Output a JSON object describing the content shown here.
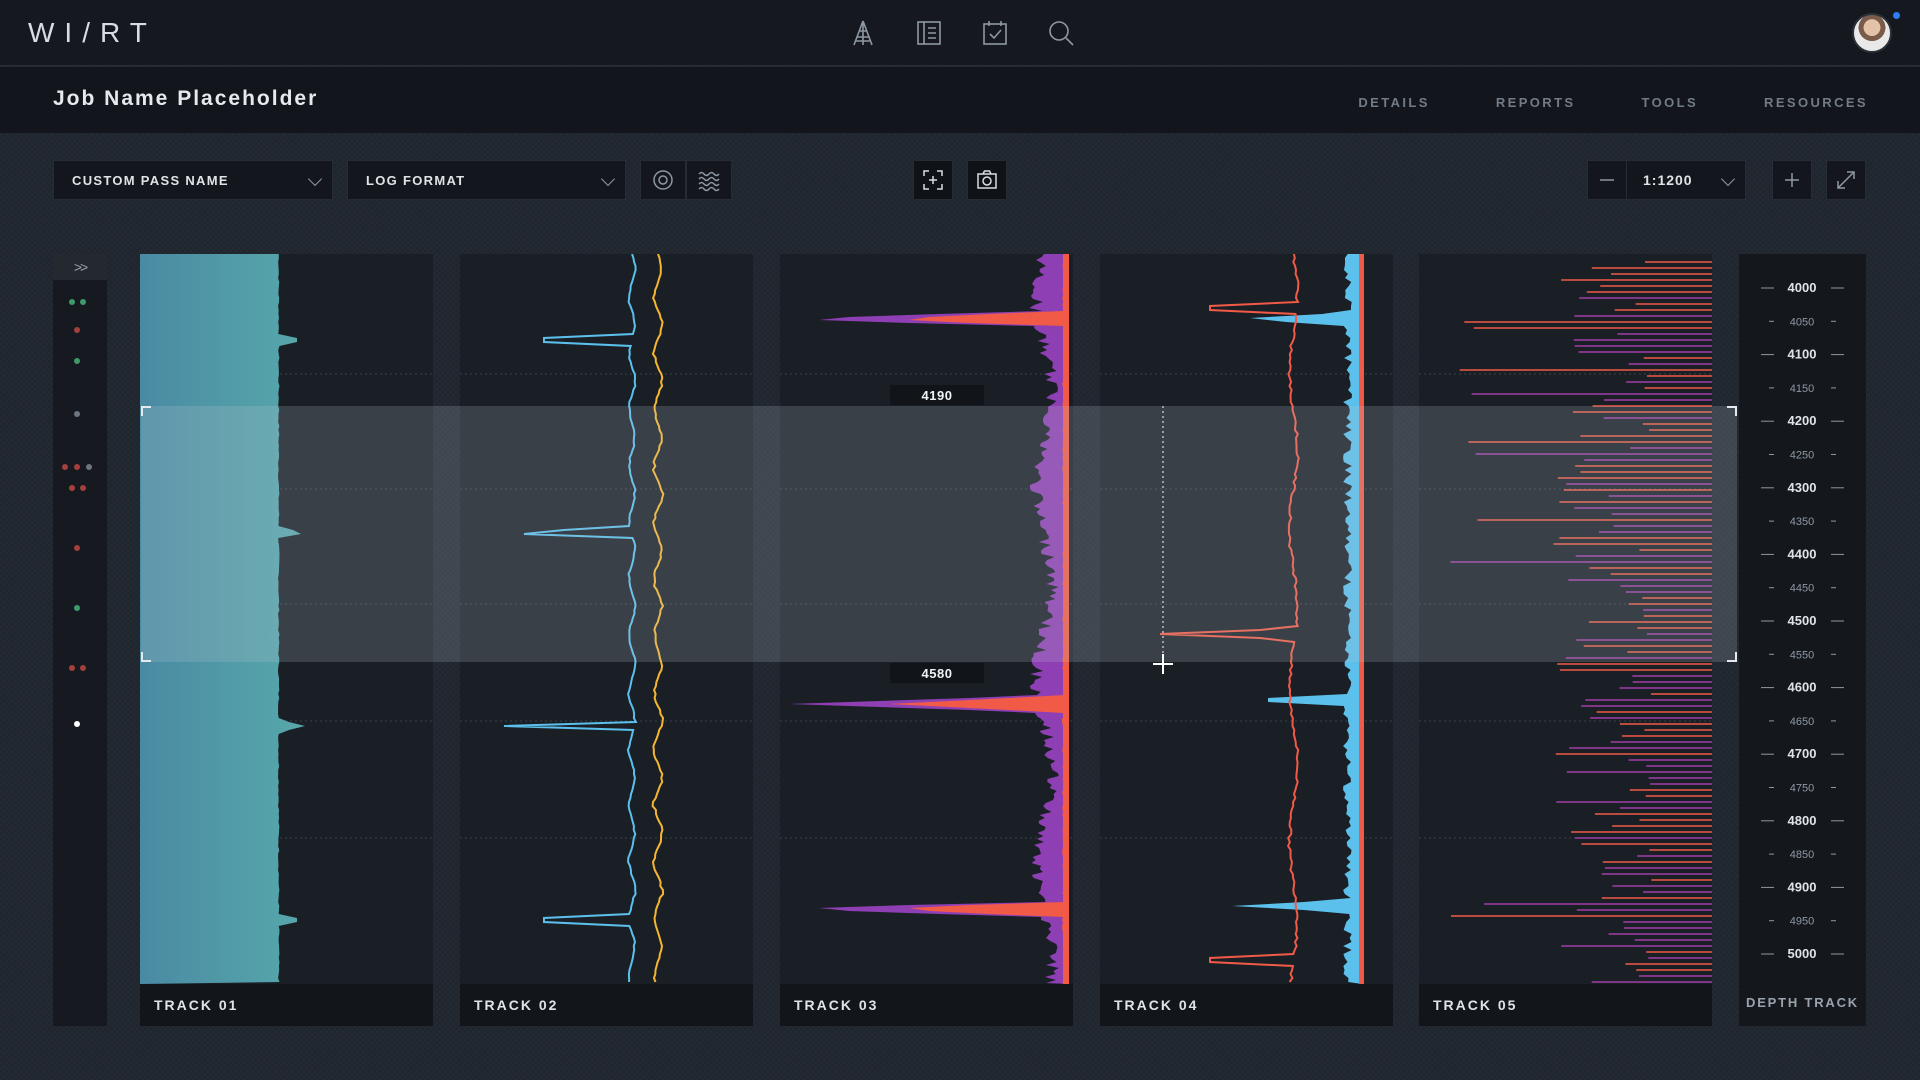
{
  "app": {
    "logo_text": "WI/RT",
    "nav_icons": [
      "rig-icon",
      "document-icon",
      "clipboard-check-icon",
      "search-icon"
    ],
    "accent": "#2f7df6"
  },
  "job": {
    "title": "Job Name Placeholder",
    "tabs": [
      {
        "label": "DETAILS"
      },
      {
        "label": "REPORTS"
      },
      {
        "label": "TOOLS"
      },
      {
        "label": "RESOURCES"
      }
    ]
  },
  "toolbar": {
    "pass_dropdown": "CUSTOM PASS NAME",
    "format_dropdown": "LOG FORMAT",
    "scale": "1:1200"
  },
  "tracks": [
    {
      "label": "TRACK  01",
      "color": "#4a98ad"
    },
    {
      "label": "TRACK  02",
      "colors": [
        "#5bc0eb",
        "#f5b731"
      ]
    },
    {
      "label": "TRACK  03",
      "colors": [
        "#8e3fb3",
        "#f05a46"
      ]
    },
    {
      "label": "TRACK  04",
      "colors": [
        "#f05a46",
        "#5bc0eb"
      ]
    },
    {
      "label": "TRACK  05",
      "colors": [
        "#a23ea8",
        "#f05a46"
      ]
    }
  ],
  "depth": {
    "label": "DEPTH TRACK",
    "ticks": [
      "4000",
      "4050",
      "4100",
      "4150",
      "4200",
      "4250",
      "4300",
      "4350",
      "4400",
      "4450",
      "4500",
      "4550",
      "4600",
      "4650",
      "4700",
      "4750",
      "4800",
      "4850",
      "4900",
      "4950",
      "5000"
    ]
  },
  "selection": {
    "top_depth": "4190",
    "bottom_depth": "4580"
  }
}
